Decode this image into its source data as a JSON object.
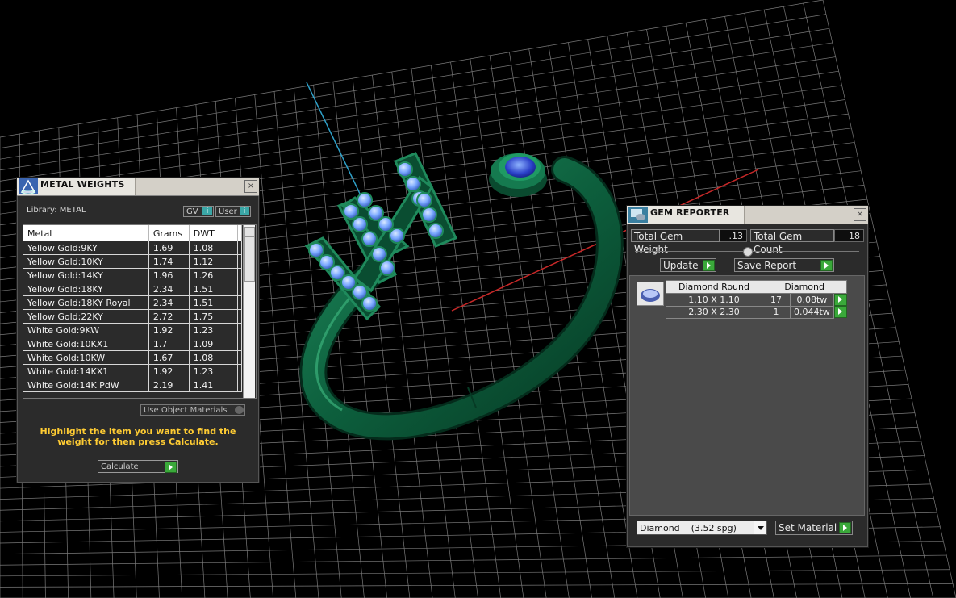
{
  "metal_weights": {
    "title": "METAL WEIGHTS",
    "close_glyph": "×",
    "library_label": "Library: METAL",
    "gv_label": "GV",
    "user_label": "User",
    "info_glyph": "i",
    "columns": [
      "Metal",
      "Grams",
      "DWT"
    ],
    "rows": [
      {
        "metal": "Yellow Gold:9KY",
        "grams": "1.69",
        "dwt": "1.08"
      },
      {
        "metal": "Yellow Gold:10KY",
        "grams": "1.74",
        "dwt": "1.12"
      },
      {
        "metal": "Yellow Gold:14KY",
        "grams": "1.96",
        "dwt": "1.26"
      },
      {
        "metal": "Yellow Gold:18KY",
        "grams": "2.34",
        "dwt": "1.51"
      },
      {
        "metal": "Yellow Gold:18KY Royal",
        "grams": "2.34",
        "dwt": "1.51"
      },
      {
        "metal": "Yellow Gold:22KY",
        "grams": "2.72",
        "dwt": "1.75"
      },
      {
        "metal": "White Gold:9KW",
        "grams": "1.92",
        "dwt": "1.23"
      },
      {
        "metal": "White Gold:10KX1",
        "grams": "1.7",
        "dwt": "1.09"
      },
      {
        "metal": "White Gold:10KW",
        "grams": "1.67",
        "dwt": "1.08"
      },
      {
        "metal": "White Gold:14KX1",
        "grams": "1.92",
        "dwt": "1.23"
      },
      {
        "metal": "White Gold:14K PdW",
        "grams": "2.19",
        "dwt": "1.41"
      }
    ],
    "use_object_materials_label": "Use Object Materials",
    "instruction": "Highlight the item you want to find the weight for then press Calculate.",
    "calculate_label": "Calculate"
  },
  "gem_reporter": {
    "title": "GEM REPORTER",
    "close_glyph": "×",
    "total_gem_weight_label": "Total Gem Weight",
    "total_gem_weight_value": ".13",
    "total_gem_count_label": "Total Gem Count",
    "total_gem_count_value": "18",
    "update_label": "Update",
    "save_report_label": "Save Report",
    "columns": [
      "Diamond Round",
      "Diamond"
    ],
    "rows": [
      {
        "size": "1.10 X 1.10",
        "count": "17",
        "weight": "0.08tw"
      },
      {
        "size": "2.30 X 2.30",
        "count": "1",
        "weight": "0.044tw"
      }
    ],
    "material_select_value": "Diamond    (3.52 spg)",
    "set_material_label": "Set Material"
  },
  "scene": {
    "ring_color": "#0f6b45",
    "gem_color": "#6fa6ff",
    "grid_color": "#7a7a7a",
    "axis_x_color": "#c82828",
    "axis_y_color": "#2ea0c8"
  }
}
